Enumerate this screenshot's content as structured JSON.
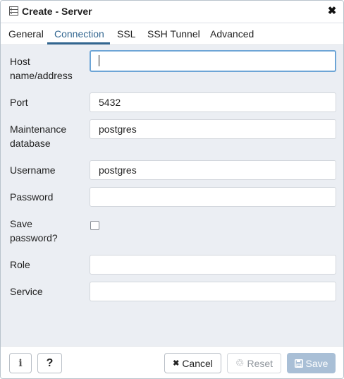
{
  "dialog": {
    "title": "Create - Server",
    "close_glyph": "✖"
  },
  "tabs": [
    {
      "label": "General"
    },
    {
      "label": "Connection",
      "active": true
    },
    {
      "label": "SSL"
    },
    {
      "label": "SSH Tunnel"
    },
    {
      "label": "Advanced"
    }
  ],
  "form": {
    "host": {
      "label_line1": "Host",
      "label_line2": "name/address",
      "value": ""
    },
    "port": {
      "label": "Port",
      "value": "5432"
    },
    "maintenance_db": {
      "label_line1": "Maintenance",
      "label_line2": "database",
      "value": "postgres"
    },
    "username": {
      "label": "Username",
      "value": "postgres"
    },
    "password": {
      "label": "Password",
      "value": ""
    },
    "save_password": {
      "label_line1": "Save",
      "label_line2": "password?",
      "checked": false
    },
    "role": {
      "label": "Role",
      "value": ""
    },
    "service": {
      "label": "Service",
      "value": ""
    }
  },
  "footer": {
    "info_glyph": "i",
    "help_glyph": "?",
    "cancel_label": "Cancel",
    "cancel_glyph": "✖",
    "reset_label": "Reset",
    "reset_glyph": "♲",
    "save_label": "Save",
    "save_glyph": "🖫"
  },
  "colors": {
    "accent": "#326690",
    "focus_border": "#6da5d6",
    "save_button": "#a9bfd6"
  },
  "icons": {
    "title": "server-icon",
    "close": "close-icon",
    "info": "info-icon",
    "help": "question-icon",
    "cancel": "x-icon",
    "reset": "recycle-icon",
    "save": "floppy-disk-icon"
  }
}
